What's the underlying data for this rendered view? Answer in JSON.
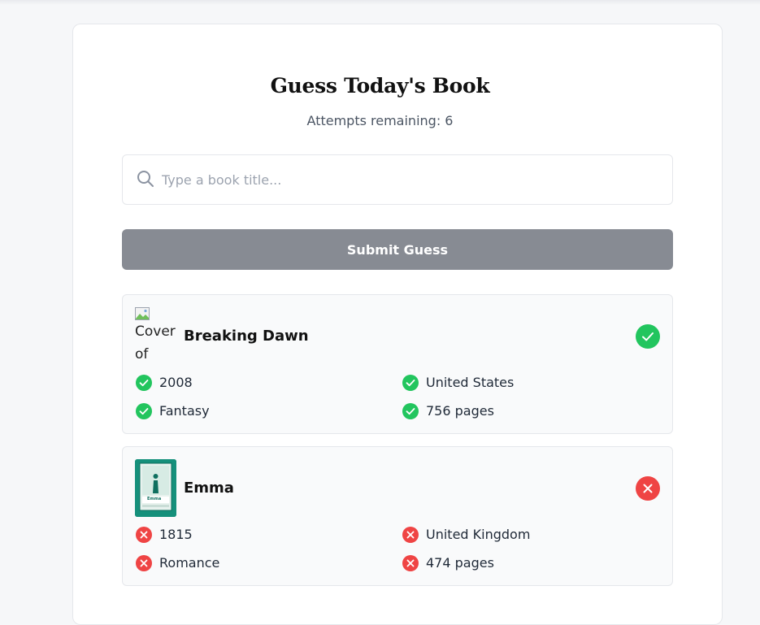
{
  "header": {
    "title": "Guess Today's Book",
    "attempts": "Attempts remaining: 6"
  },
  "search": {
    "placeholder": "Type a book title...",
    "value": ""
  },
  "submit_label": "Submit Guess",
  "guesses": [
    {
      "title": "Breaking Dawn",
      "cover_alt": "Cover of",
      "correct": true,
      "attributes": [
        {
          "label": "2008",
          "correct": true
        },
        {
          "label": "United States",
          "correct": true
        },
        {
          "label": "Fantasy",
          "correct": true
        },
        {
          "label": "756 pages",
          "correct": true
        }
      ]
    },
    {
      "title": "Emma",
      "cover_text": "Emma",
      "correct": false,
      "attributes": [
        {
          "label": "1815",
          "correct": false
        },
        {
          "label": "United Kingdom",
          "correct": false
        },
        {
          "label": "Romance",
          "correct": false
        },
        {
          "label": "474 pages",
          "correct": false
        }
      ]
    }
  ],
  "colors": {
    "correct": "#22c55e",
    "incorrect": "#ef4444",
    "button_disabled": "#878b93"
  }
}
